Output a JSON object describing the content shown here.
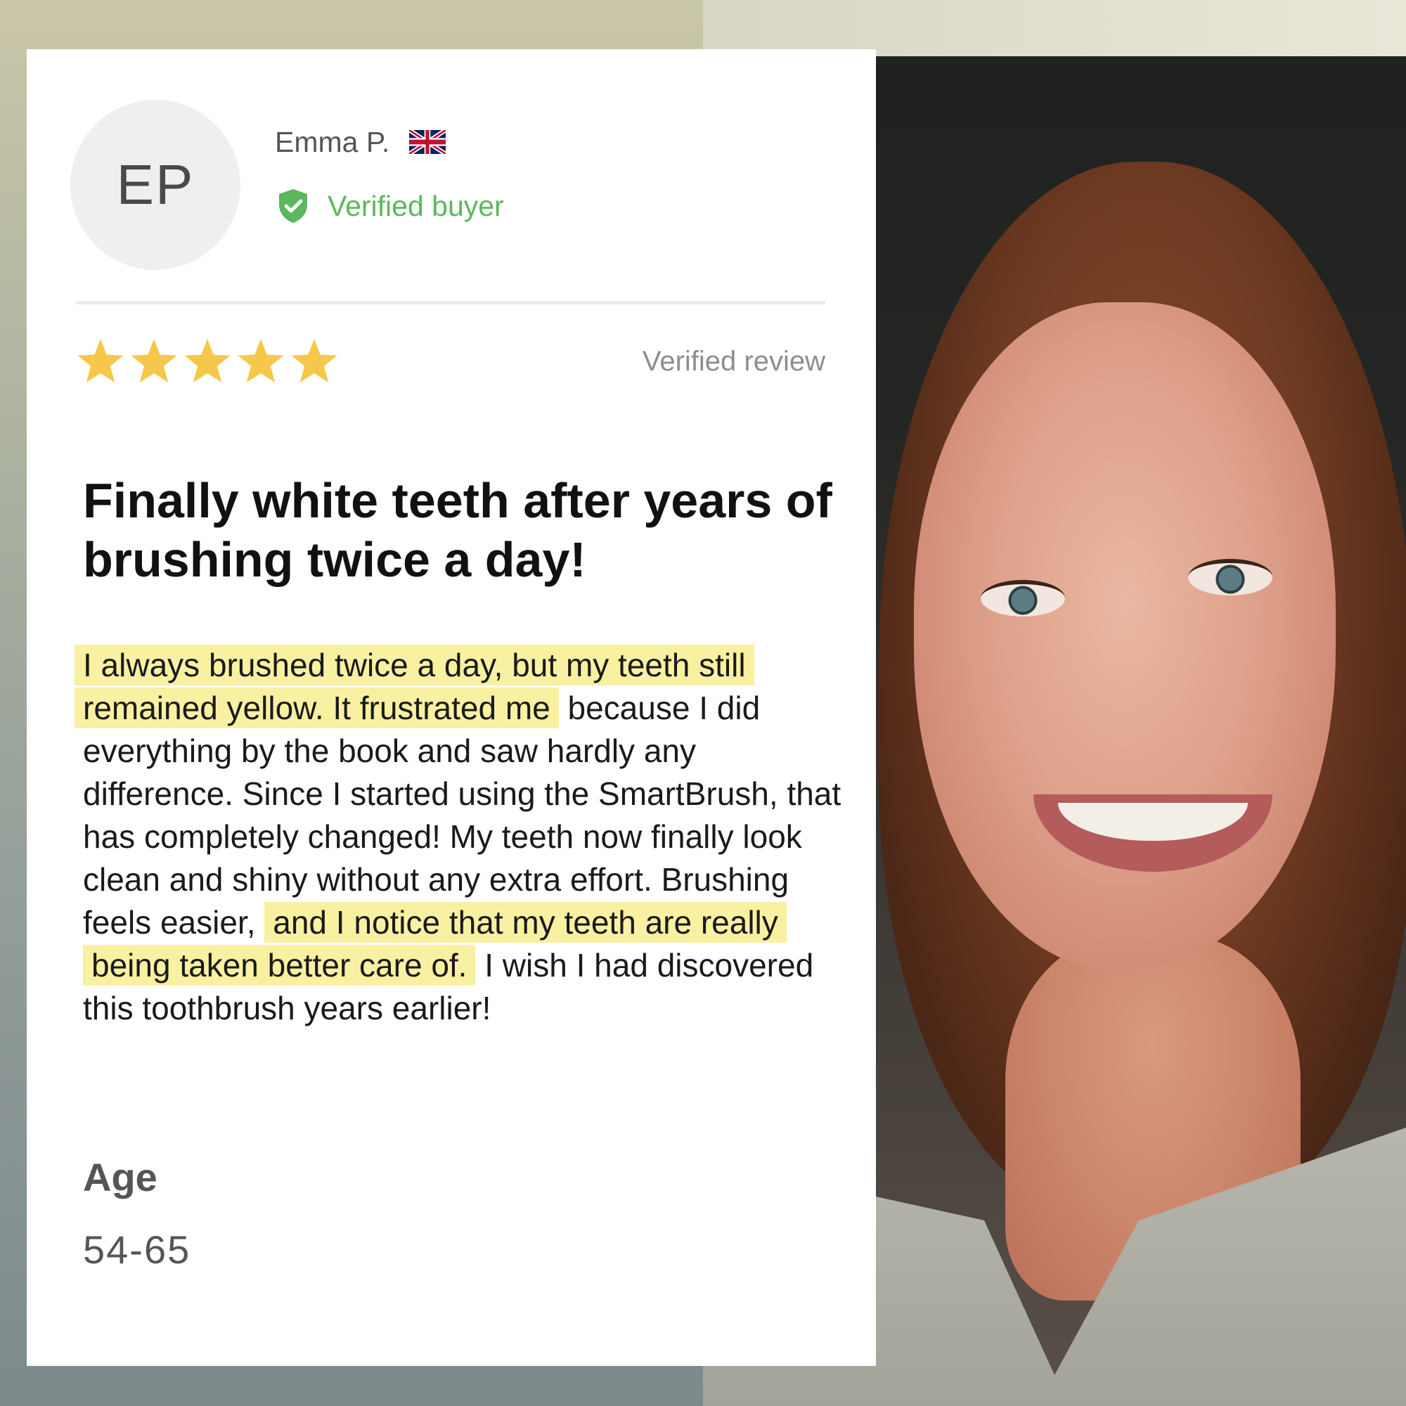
{
  "reviewer": {
    "initials": "EP",
    "name": "Emma P.",
    "flag_icon": "uk-flag-icon",
    "verified_label": "Verified buyer",
    "verified_icon": "shield-check-icon",
    "verified_color": "#5bb85c"
  },
  "review": {
    "rating": 5,
    "max_rating": 5,
    "star_color": "#f5c84c",
    "verified_label": "Verified review",
    "title": "Finally white teeth after years of brushing twice a day!",
    "body_segments": [
      {
        "text": "I always brushed twice a day, but my teeth still remained yellow. It frustrated me",
        "highlight": true
      },
      {
        "text": " because I did everything by the book and saw hardly any difference. Since I started using the SmartBrush, that has completely changed! My teeth now finally look clean and shiny without any extra effort. Brushing feels easier, ",
        "highlight": false
      },
      {
        "text": "and I notice that my teeth are really being taken better care of.",
        "highlight": true
      },
      {
        "text": " I wish I had discovered this toothbrush years earlier!",
        "highlight": false
      }
    ],
    "highlight_color": "#f8f1a2"
  },
  "demographics": {
    "age_label": "Age",
    "age_value": "54-65"
  }
}
